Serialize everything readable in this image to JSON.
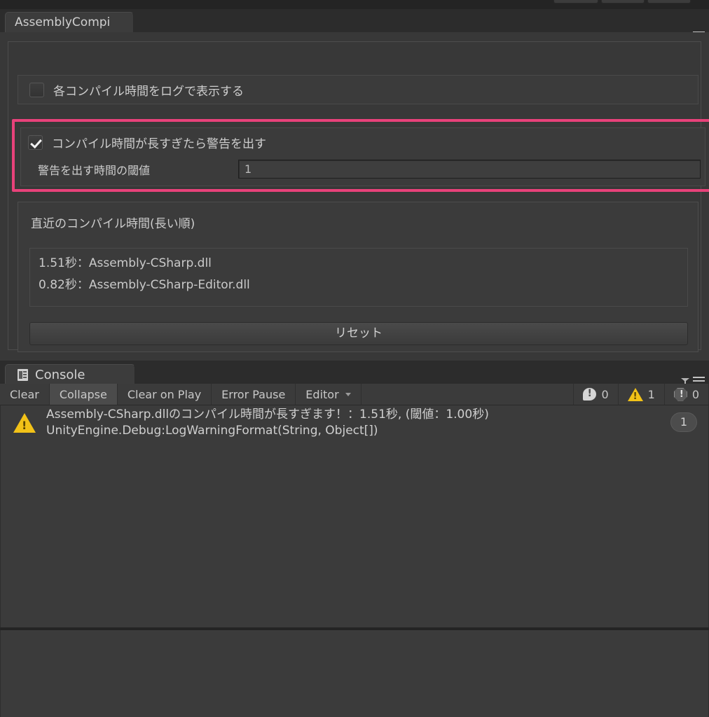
{
  "top_toolbar": {
    "stub_count": 3
  },
  "assembly_panel": {
    "tab_label": "AssemblyCompi",
    "menu_icons": [
      "filter-icon",
      "hamburger-menu-icon"
    ],
    "log_each_compile": {
      "label": "各コンパイル時間をログで表示する",
      "checked": false
    },
    "warn_on_long_compile": {
      "label": "コンパイル時間が長すぎたら警告を出す",
      "checked": true,
      "threshold_label": "警告を出す時間の閾値",
      "threshold_value": "1",
      "threshold_placeholder": "",
      "highlight_color": "#e8427a"
    },
    "recent": {
      "title": "直近のコンパイル時間(長い順)",
      "items": [
        "1.51秒：Assembly-CSharp.dll",
        "0.82秒：Assembly-CSharp-Editor.dll"
      ],
      "reset_label": "リセット"
    }
  },
  "console_panel": {
    "tab_label": "Console",
    "tab_icon": "console-icon",
    "menu_icons": [
      "filter-icon",
      "hamburger-menu-icon"
    ],
    "toolbar": {
      "clear_label": "Clear",
      "collapse_label": "Collapse",
      "clear_on_play_label": "Clear on Play",
      "error_pause_label": "Error Pause",
      "editor_label": "Editor",
      "counts": {
        "info": "0",
        "warning": "1",
        "error": "0"
      }
    },
    "entries": [
      {
        "severity": "warning",
        "line1": "Assembly-CSharp.dllのコンパイル時間が長すぎます！：1.51秒, (閾値：1.00秒)",
        "line2": "UnityEngine.Debug:LogWarningFormat(String, Object[])",
        "collapse_count": "1"
      }
    ]
  }
}
